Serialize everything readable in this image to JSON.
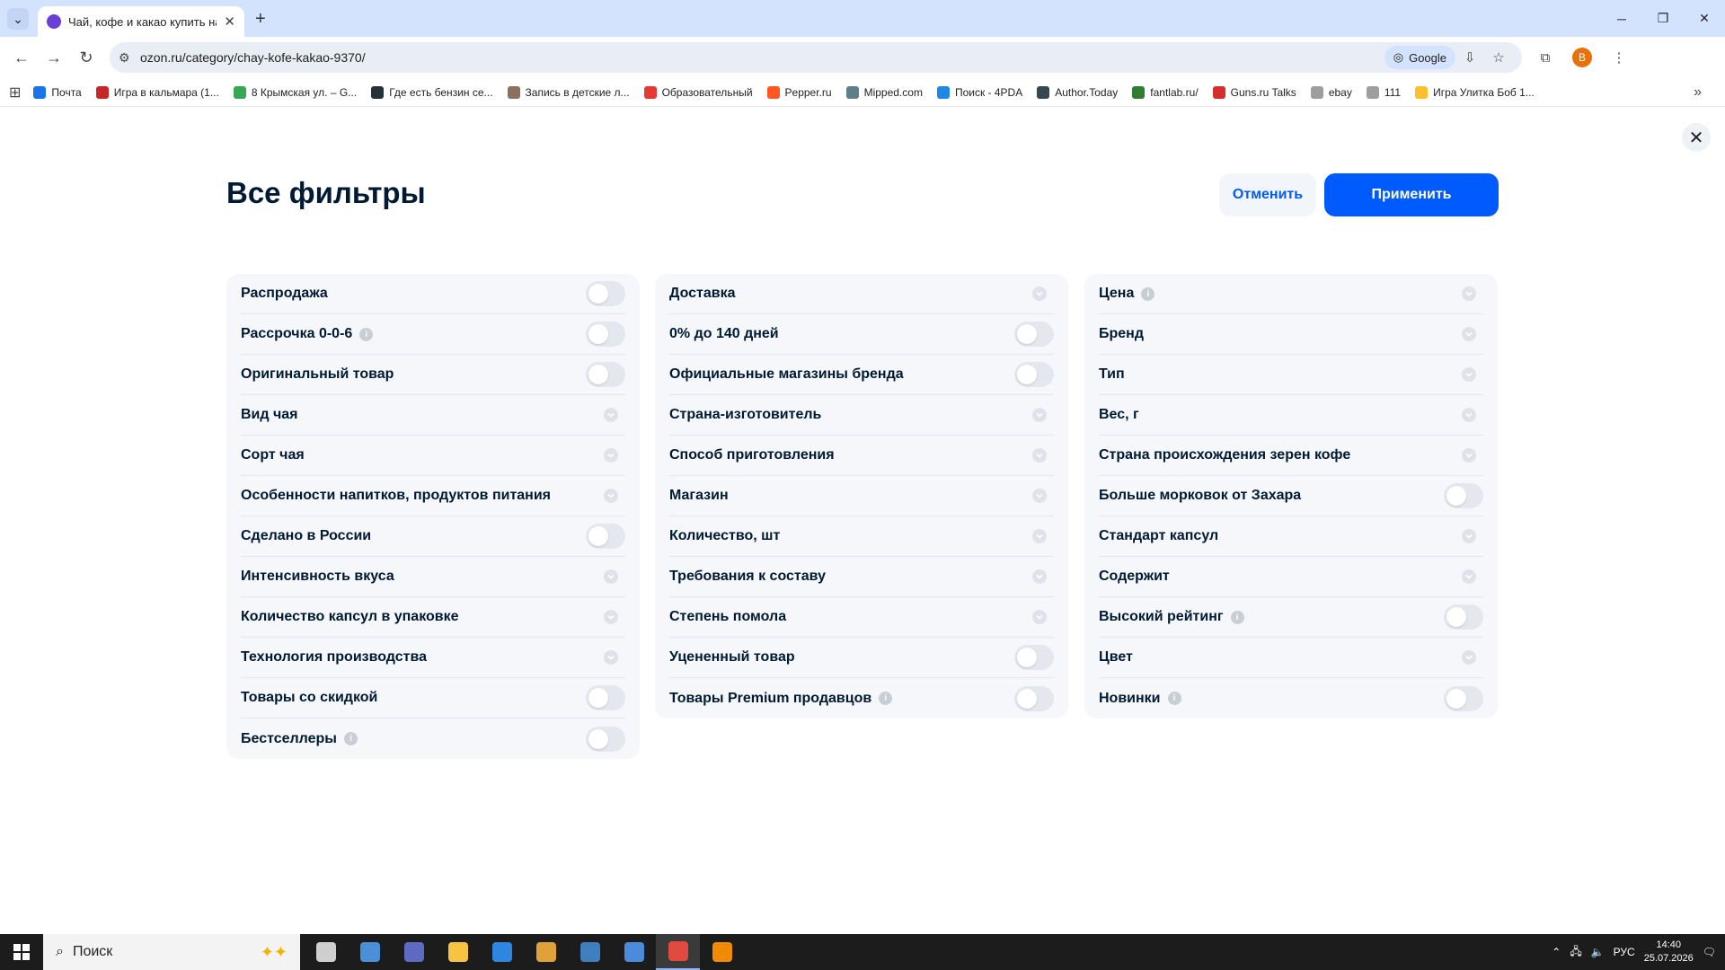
{
  "browser": {
    "tab_title": "Чай, кофе и какао купить на О",
    "url": "ozon.ru/category/chay-kofe-kakao-9370/",
    "google_button": "Google",
    "profile_initial": "B",
    "bookmarks": [
      {
        "label": "Почта",
        "color": "#1a73e8"
      },
      {
        "label": "Игра в кальмара (1...",
        "color": "#c62828"
      },
      {
        "label": "8 Крымская ул. – G...",
        "color": "#34a853"
      },
      {
        "label": "Где есть бензин се...",
        "color": "#263238"
      },
      {
        "label": "Запись в детские л...",
        "color": "#8d6e63"
      },
      {
        "label": "Образовательный",
        "color": "#e53935"
      },
      {
        "label": "Pepper.ru",
        "color": "#ff5722"
      },
      {
        "label": "Mipped.com",
        "color": "#607d8b"
      },
      {
        "label": "Поиск - 4PDA",
        "color": "#1e88e5"
      },
      {
        "label": "Author.Today",
        "color": "#37474f"
      },
      {
        "label": "fantlab.ru/",
        "color": "#2e7d32"
      },
      {
        "label": "Guns.ru Talks",
        "color": "#d32f2f"
      },
      {
        "label": "ebay",
        "color": "#9e9e9e"
      },
      {
        "label": "111",
        "color": "#9e9e9e"
      },
      {
        "label": "Игра Улитка Боб 1...",
        "color": "#fbc02d"
      }
    ]
  },
  "page": {
    "title": "Все фильтры",
    "cancel_label": "Отменить",
    "apply_label": "Применить"
  },
  "columns": [
    [
      {
        "label": "Распродажа",
        "control": "toggle",
        "info": false
      },
      {
        "label": "Рассрочка 0-0-6",
        "control": "toggle",
        "info": true
      },
      {
        "label": "Оригинальный товар",
        "control": "toggle",
        "info": false
      },
      {
        "label": "Вид чая",
        "control": "expand",
        "info": false
      },
      {
        "label": "Сорт чая",
        "control": "expand",
        "info": false
      },
      {
        "label": "Особенности напитков, продуктов питания",
        "control": "expand",
        "info": false
      },
      {
        "label": "Сделано в России",
        "control": "toggle",
        "info": false
      },
      {
        "label": "Интенсивность вкуса",
        "control": "expand",
        "info": false
      },
      {
        "label": "Количество капсул в упаковке",
        "control": "expand",
        "info": false
      },
      {
        "label": "Технология производства",
        "control": "expand",
        "info": false
      },
      {
        "label": "Товары со скидкой",
        "control": "toggle",
        "info": false
      },
      {
        "label": "Бестселлеры",
        "control": "toggle",
        "info": true
      }
    ],
    [
      {
        "label": "Доставка",
        "control": "expand",
        "info": false
      },
      {
        "label": "0% до 140 дней",
        "control": "toggle",
        "info": false
      },
      {
        "label": "Официальные магазины бренда",
        "control": "toggle",
        "info": false
      },
      {
        "label": "Страна-изготовитель",
        "control": "expand",
        "info": false
      },
      {
        "label": "Способ приготовления",
        "control": "expand",
        "info": false
      },
      {
        "label": "Магазин",
        "control": "expand",
        "info": false
      },
      {
        "label": "Количество, шт",
        "control": "expand",
        "info": false
      },
      {
        "label": "Требования к составу",
        "control": "expand",
        "info": false
      },
      {
        "label": "Степень помола",
        "control": "expand",
        "info": false
      },
      {
        "label": "Уцененный товар",
        "control": "toggle",
        "info": false
      },
      {
        "label": "Товары Premium продавцов",
        "control": "toggle",
        "info": true
      }
    ],
    [
      {
        "label": "Цена",
        "control": "expand",
        "info": true
      },
      {
        "label": "Бренд",
        "control": "expand",
        "info": false
      },
      {
        "label": "Тип",
        "control": "expand",
        "info": false
      },
      {
        "label": "Вес, г",
        "control": "expand",
        "info": false
      },
      {
        "label": "Страна происхождения зерен кофе",
        "control": "expand",
        "info": false
      },
      {
        "label": "Больше морковок от Захара",
        "control": "toggle",
        "info": false
      },
      {
        "label": "Стандарт капсул",
        "control": "expand",
        "info": false
      },
      {
        "label": "Содержит",
        "control": "expand",
        "info": false
      },
      {
        "label": "Высокий рейтинг",
        "control": "toggle",
        "info": true
      },
      {
        "label": "Цвет",
        "control": "expand",
        "info": false
      },
      {
        "label": "Новинки",
        "control": "toggle",
        "info": true
      }
    ]
  ],
  "taskbar": {
    "search_placeholder": "Поиск",
    "language": "РУС",
    "time": "14:40",
    "date": "25.07.2026",
    "apps": [
      {
        "name": "task-view",
        "color": "#cfcfcf",
        "active": false
      },
      {
        "name": "app-2",
        "color": "#4a90d9",
        "active": false
      },
      {
        "name": "calculator",
        "color": "#5c6bc0",
        "active": false
      },
      {
        "name": "file-explorer",
        "color": "#f6c343",
        "active": false
      },
      {
        "name": "app-5",
        "color": "#2e86de",
        "active": false
      },
      {
        "name": "app-6",
        "color": "#e1a13a",
        "active": false
      },
      {
        "name": "mp3-app",
        "color": "#3f7fbf",
        "active": false
      },
      {
        "name": "qbittorrent",
        "color": "#4a8cdb",
        "active": false
      },
      {
        "name": "chrome",
        "color": "#e04a3f",
        "active": true
      },
      {
        "name": "vlc",
        "color": "#f08a00",
        "active": false
      }
    ]
  },
  "colors": {
    "accent": "#005bff",
    "panel_bg": "#f5f7fa",
    "title": "#001a34"
  }
}
